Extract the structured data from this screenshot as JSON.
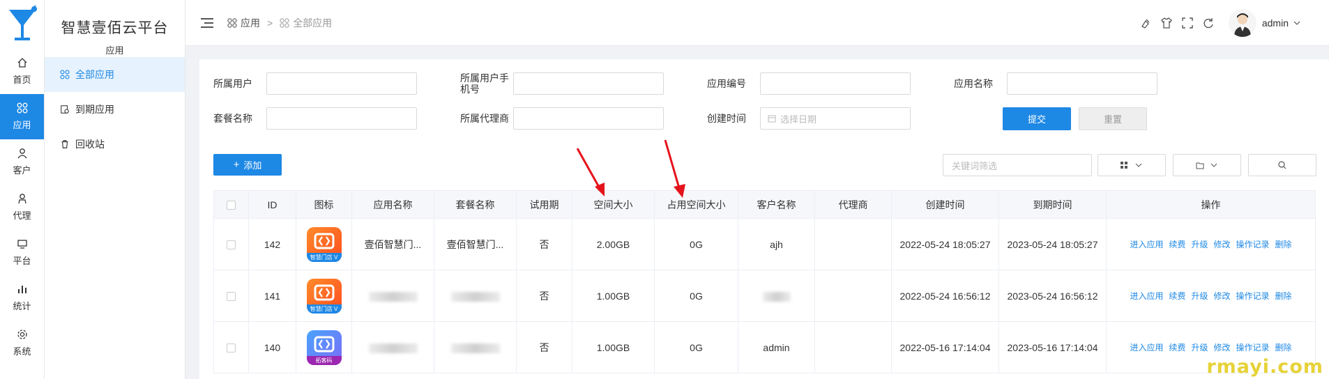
{
  "brand": {
    "title": "智慧壹佰云平台",
    "subtitle": "应用"
  },
  "rail": [
    {
      "label": "首页",
      "icon": "home-icon"
    },
    {
      "label": "应用",
      "icon": "apps-icon",
      "active": true
    },
    {
      "label": "客户",
      "icon": "user-icon"
    },
    {
      "label": "代理",
      "icon": "agent-icon"
    },
    {
      "label": "平台",
      "icon": "monitor-icon"
    },
    {
      "label": "统计",
      "icon": "bar-chart-icon"
    },
    {
      "label": "系统",
      "icon": "gear-icon"
    }
  ],
  "sidebar": [
    {
      "label": "全部应用",
      "icon": "apps-icon",
      "active": true
    },
    {
      "label": "到期应用",
      "icon": "expire-icon"
    },
    {
      "label": "回收站",
      "icon": "trash-icon"
    }
  ],
  "breadcrumb": {
    "first": "应用",
    "sep": ">",
    "second": "全部应用"
  },
  "user": {
    "name": "admin"
  },
  "filters": {
    "owner_user": "所属用户",
    "owner_phone": "所属用户手机号",
    "app_no": "应用编号",
    "app_name": "应用名称",
    "plan_name": "套餐名称",
    "agent": "所属代理商",
    "created": "创建时间",
    "date_placeholder": "选择日期",
    "submit": "提交",
    "reset": "重置"
  },
  "toolbar": {
    "add": "添加",
    "keyword_placeholder": "关键词筛选"
  },
  "table": {
    "headers": [
      "ID",
      "图标",
      "应用名称",
      "套餐名称",
      "试用期",
      "空间大小",
      "占用空间大小",
      "客户名称",
      "代理商",
      "创建时间",
      "到期时间",
      "操作"
    ],
    "rows": [
      {
        "id": "142",
        "icon_tag": "智慧门店 V",
        "icon_style": "orange",
        "app_name": "壹佰智慧门...",
        "plan_name": "壹佰智慧门...",
        "trial": "否",
        "space": "2.00GB",
        "used": "0G",
        "customer": "ajh",
        "agent": "",
        "created": "2022-05-24 18:05:27",
        "expires": "2023-05-24 18:05:27"
      },
      {
        "id": "141",
        "icon_tag": "智慧门店 V",
        "icon_style": "orange",
        "app_name": "",
        "plan_name": "",
        "trial": "否",
        "space": "1.00GB",
        "used": "0G",
        "customer": "",
        "agent": "",
        "created": "2022-05-24 16:56:12",
        "expires": "2023-05-24 16:56:12"
      },
      {
        "id": "140",
        "icon_tag": "拓客码",
        "icon_style": "blue",
        "app_name": "",
        "plan_name": "",
        "trial": "否",
        "space": "1.00GB",
        "used": "0G",
        "customer": "admin",
        "agent": "",
        "created": "2022-05-16 17:14:04",
        "expires": "2023-05-16 17:14:04"
      }
    ],
    "ops": [
      "进入应用",
      "续费",
      "升级",
      "修改",
      "操作记录",
      "删除"
    ]
  },
  "watermark": "rmayi.com"
}
